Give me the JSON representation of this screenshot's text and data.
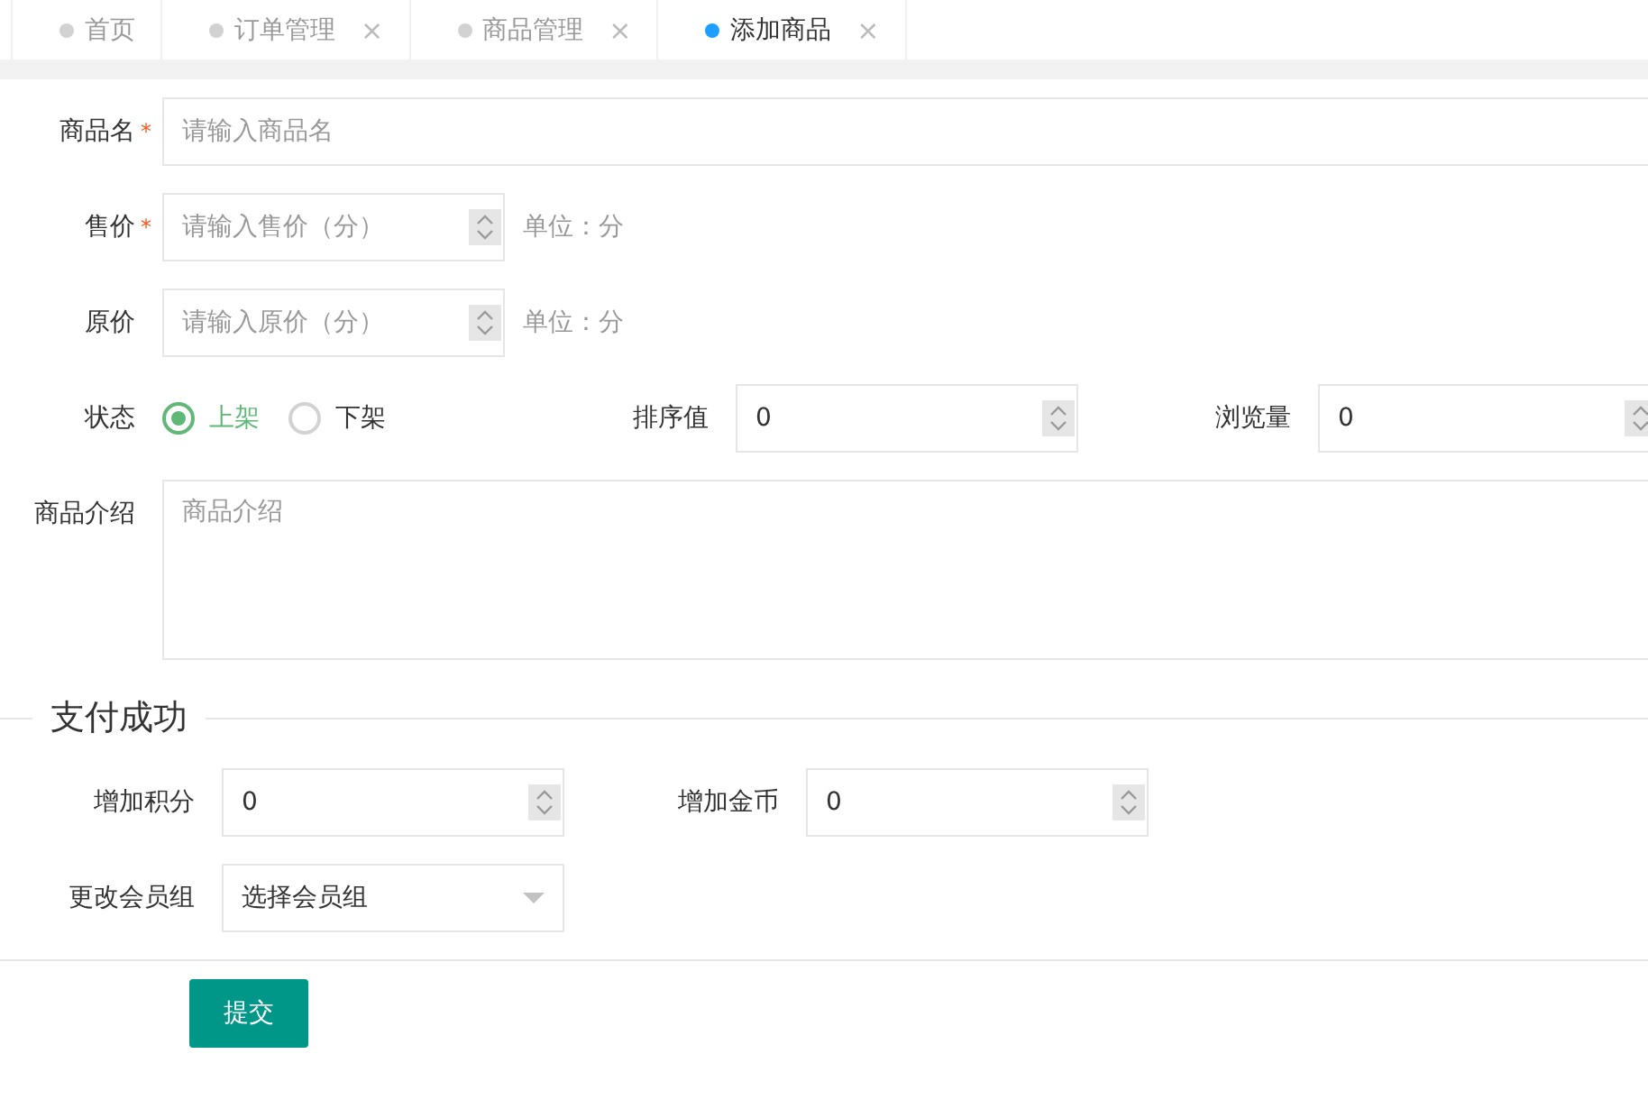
{
  "tabs": [
    {
      "label": "首页",
      "selected": false
    },
    {
      "label": "订单管理",
      "selected": false,
      "close": "×"
    },
    {
      "label": "商品管理",
      "selected": false,
      "close": "×"
    },
    {
      "label": "添加商品",
      "selected": true,
      "close": "×"
    }
  ],
  "product": {
    "name": {
      "label": "商品名",
      "required_mark": "*",
      "placeholder": "请输入商品名"
    },
    "price": {
      "label": "售价",
      "required_mark": "*",
      "placeholder": "请输入售价（分）",
      "unit": "单位：分"
    },
    "original_price": {
      "label": "原价",
      "placeholder": "请输入原价（分）",
      "unit": "单位：分"
    },
    "status": {
      "label": "状态",
      "options": [
        {
          "label": "上架",
          "selected": true
        },
        {
          "label": "下架",
          "selected": false
        }
      ]
    },
    "sort": {
      "label": "排序值",
      "value": "0"
    },
    "views": {
      "label": "浏览量",
      "value": "0"
    },
    "description": {
      "label": "商品介绍",
      "placeholder": "商品介绍"
    }
  },
  "payment_section": {
    "title": "支付成功",
    "points": {
      "label": "增加积分",
      "value": "0"
    },
    "coins": {
      "label": "增加金币",
      "value": "0"
    },
    "member_group": {
      "label": "更改会员组",
      "value": "选择会员组"
    }
  },
  "submit": "提交"
}
